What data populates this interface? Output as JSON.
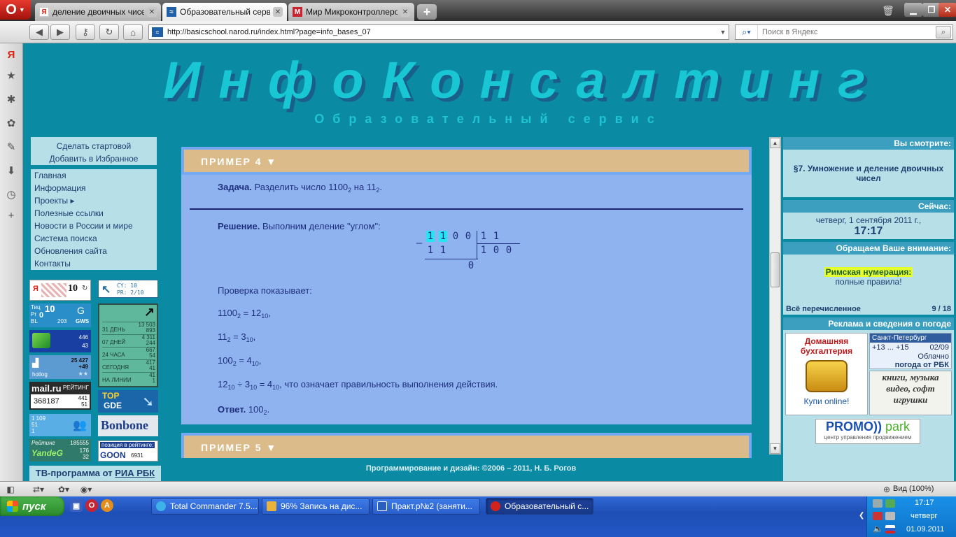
{
  "browser": {
    "tabs": [
      {
        "label": "деление двоичных чисе..."
      },
      {
        "label": "Образовательный серв..."
      },
      {
        "label": "Мир Микроконтроллеро..."
      }
    ],
    "url": "http://basicschool.narod.ru/index.html?page=info_bases_07",
    "search_placeholder": "Поиск в Яндекс",
    "zoom": "Вид (100%)"
  },
  "site": {
    "title": "ИнфоКонсалтинг",
    "subtitle": "Образовательный сервис",
    "start_links": [
      "Сделать стартовой",
      "Добавить в Избранное"
    ],
    "menu": [
      "Главная",
      "Информация",
      "Проекты ▸",
      "Полезные ссылки",
      "Новости в России и мире",
      "Система поиска",
      "Обновления сайта",
      "Контакты"
    ],
    "tv_prefix": "ТВ-программа от ",
    "tv_link": "РИА РБК",
    "footer": "Программирование и дизайн: ©2006 – 2011, Н. Б. Рогов"
  },
  "counters": {
    "yandex_num": "10",
    "cy": "CY: 10",
    "pr": "PR: 2/10",
    "tic": "Тиц",
    "tic_pr": "Pr",
    "tic_bl": "BL",
    "tic_val": "10",
    "tic_pr_val": "0",
    "tic_bl_val": "203",
    "tic_gws": "GWS",
    "li_rows": [
      {
        "label": "31 ДЕНЬ",
        "a": "13 503",
        "b": "893"
      },
      {
        "label": "07 ДНЕЙ",
        "a": "4 311",
        "b": "244"
      },
      {
        "label": "24 ЧАСА",
        "a": "667",
        "b": "54"
      },
      {
        "label": "СЕГОДНЯ",
        "a": "417",
        "b": "41"
      },
      {
        "label": "НА ЛИНИИ",
        "a": "41",
        "b": "1"
      }
    ],
    "rambler_a": "446",
    "rambler_b": "43",
    "hotlog_a": "25 427",
    "hotlog_b": "+49",
    "hotlog_name": "hotlog",
    "mail_logo": "mail.ru",
    "mail_rating": "РЕЙТИНГ",
    "mail_val": "368187",
    "mail_a": "441",
    "mail_b": "51",
    "top_gde_top": "TOP",
    "top_gde_name": "GDE",
    "bluebar_a": "1 109",
    "bluebar_b": "51",
    "bluebar_c": "1",
    "bonbone": "Bonbone",
    "yandeg_title": "Рейтинг",
    "yandeg_a": "185555",
    "yandeg_name": "YandeG",
    "yandeg_b": "176",
    "yandeg_c": "32",
    "goon_title": "позиция в рейтинге:",
    "goon_name": "GOON",
    "goon_val": "6931"
  },
  "example4": {
    "header": "ПРИМЕР 4 ▼",
    "task_label": "Задача.",
    "task_text": " Разделить число 1100",
    "task_sub1": "2",
    "task_mid": " на 11",
    "task_sub2": "2",
    "task_end": ".",
    "solution_label": "Решение.",
    "solution_text": " Выполним деление \"углом\":",
    "division": {
      "minus": "–",
      "dividend": [
        "1",
        "1",
        "0",
        "0"
      ],
      "divisor": [
        "1",
        "1"
      ],
      "subtract": [
        "1",
        "1"
      ],
      "quotient": [
        "1",
        "0",
        "0"
      ],
      "remainder": "0"
    },
    "check_intro": "Проверка показывает:",
    "lines": [
      {
        "a": "1100",
        "as": "2",
        "eq": " = 12",
        "bs": "10",
        "end": ","
      },
      {
        "a": "11",
        "as": "2",
        "eq": " = 3",
        "bs": "10",
        "end": ","
      },
      {
        "a": "100",
        "as": "2",
        "eq": " = 4",
        "bs": "10",
        "end": ","
      }
    ],
    "final_a": "12",
    "final_as": "10",
    "final_op": " ÷ 3",
    "final_bs": "10",
    "final_eq": " = 4",
    "final_cs": "10",
    "final_text": ", что означает правильность выполнения действия.",
    "answer_label": "Ответ.",
    "answer_val": " 100",
    "answer_sub": "2",
    "answer_end": "."
  },
  "example5": {
    "header": "ПРИМЕР 5 ▼"
  },
  "right": {
    "viewing_title": "Вы смотрите:",
    "viewing_text": "§7. Умножение и деление двоичных чисел",
    "now_title": "Сейчас:",
    "now_date": "четверг, 1 сентября 2011 г.,",
    "now_time": "17:17",
    "attention_title": "Обращаем Ваше внимание:",
    "attention_link": "Римская нумерация:",
    "attention_sub": "полные правила!",
    "all_listed": "Всё перечисленное",
    "counter": "9 / 18",
    "ads_title": "Реклама и сведения о погоде",
    "ad_title": "Домашняя бухгалтерия",
    "ad_buy": "Купи online!",
    "weather_city": "Санкт-Петербург",
    "weather_temp": "+13 ... +15",
    "weather_date": "02/09",
    "weather_cond": "Облачно",
    "weather_src": "погода от РБК",
    "books": "книги, музыка видео, софт игрушки",
    "promo_a": "PROMO",
    "promo_b": "park",
    "promo_sub": "центр управления продвижением"
  },
  "taskbar": {
    "start": "пуск",
    "tasks": [
      {
        "label": "Total Commander 7.5..."
      },
      {
        "label": "96% Запись на дис..."
      },
      {
        "label": "Практ.р№2 (заняти..."
      },
      {
        "label": "Образовательный с..."
      }
    ],
    "time": "17:17",
    "day": "четверг",
    "date": "01.09.2011"
  },
  "colors": {
    "page_bg": "#0b8aa3",
    "title": "#18c6d4",
    "panel": "#b7dfe7",
    "example_head": "#dcbb8a",
    "example_body": "#8fb3ef"
  }
}
